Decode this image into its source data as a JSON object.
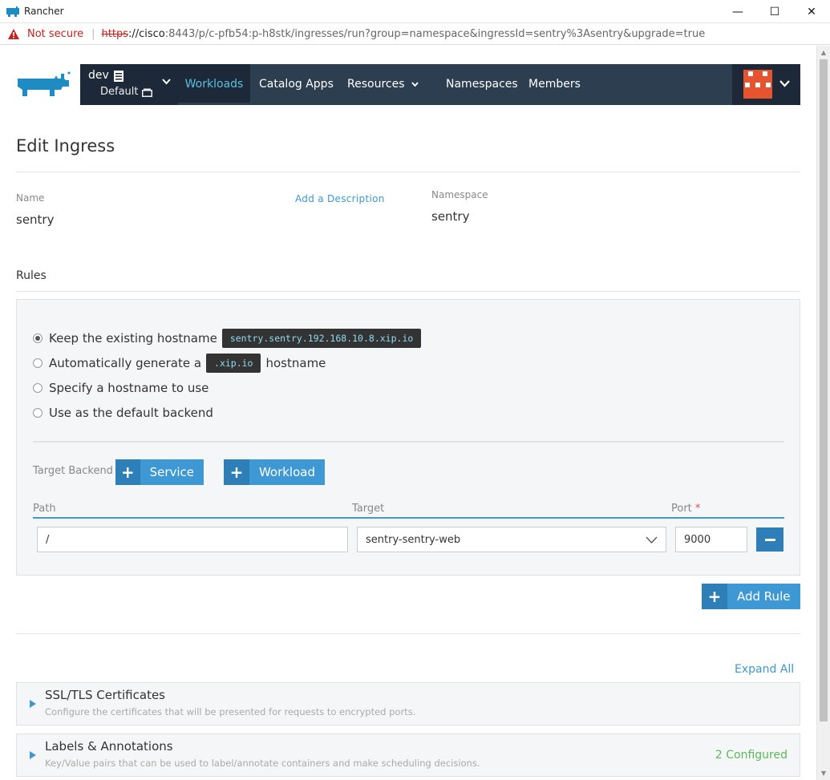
{
  "window": {
    "title": "Rancher",
    "minimize": "—",
    "maximize": "☐",
    "close": "✕"
  },
  "address": {
    "security_label": "Not secure",
    "url_scheme": "https",
    "url_host": "://cisco",
    "url_rest": ":8443/p/c-pfb54:p-h8stk/ingresses/run?group=namespace&ingressId=sentry%3Asentry&upgrade=true"
  },
  "nav": {
    "cluster": "dev",
    "project": "Default",
    "items": [
      "Workloads",
      "Catalog Apps",
      "Resources",
      "Namespaces",
      "Members"
    ],
    "active": "Workloads"
  },
  "page": {
    "title": "Edit Ingress",
    "name_label": "Name",
    "name_value": "sentry",
    "add_description": "Add a Description",
    "namespace_label": "Namespace",
    "namespace_value": "sentry",
    "rules_title": "Rules"
  },
  "rule": {
    "options": [
      {
        "before": "Keep the existing hostname",
        "code": "sentry.sentry.192.168.10.8.xip.io",
        "after": "",
        "checked": true
      },
      {
        "before": "Automatically generate a",
        "code": ".xip.io",
        "after": "hostname",
        "checked": false
      },
      {
        "before": "Specify a hostname to use",
        "code": "",
        "after": "",
        "checked": false
      },
      {
        "before": "Use as the default backend",
        "code": "",
        "after": "",
        "checked": false
      }
    ],
    "target_backend_label": "Target Backend",
    "service_button": "Service",
    "workload_button": "Workload",
    "col_path": "Path",
    "col_target": "Target",
    "col_port": "Port",
    "required_mark": "*",
    "path_value": "/",
    "target_value": "sentry-sentry-web",
    "port_value": "9000",
    "plus": "+"
  },
  "add_rule_button": "Add Rule",
  "expand_all": "Expand All",
  "accordions": [
    {
      "title": "SSL/TLS Certificates",
      "description": "Configure the certificates that will be presented for requests to encrypted ports.",
      "status": ""
    },
    {
      "title": "Labels & Annotations",
      "description": "Key/Value pairs that can be used to label/annotate containers and make scheduling decisions.",
      "status": "2 Configured"
    }
  ],
  "colors": {
    "navbar": "#2c3e50",
    "accent": "#3d98d3",
    "active_nav": "#5bc0de",
    "success": "#5cb85c",
    "avatar": "#e5532f"
  }
}
